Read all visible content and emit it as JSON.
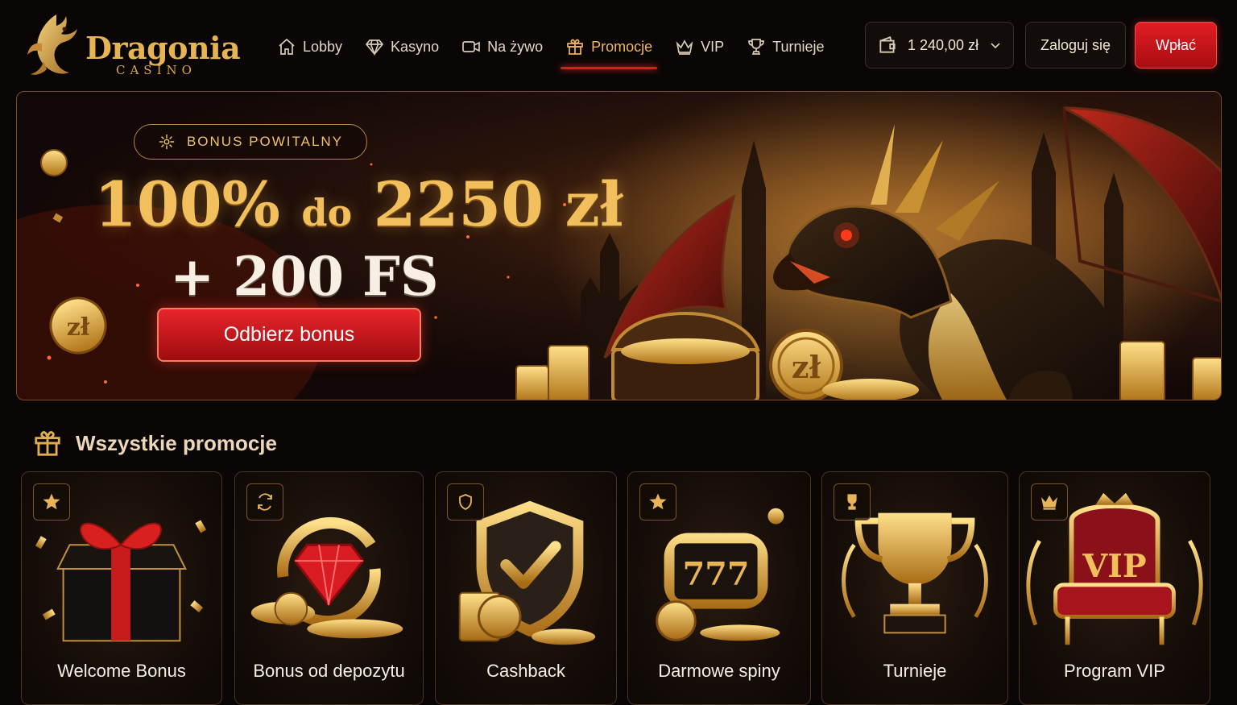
{
  "brand": {
    "name": "Dragonia",
    "sub": "CASINO"
  },
  "nav": [
    {
      "label": "Lobby",
      "icon": "home-icon"
    },
    {
      "label": "Kasyno",
      "icon": "diamond-icon"
    },
    {
      "label": "Na żywo",
      "icon": "video-icon"
    },
    {
      "label": "Promocje",
      "icon": "gift-icon",
      "active": true
    },
    {
      "label": "VIP",
      "icon": "crown-icon"
    },
    {
      "label": "Turnieje",
      "icon": "trophy-icon"
    }
  ],
  "wallet": {
    "balance": "1 240,00 zł",
    "icon": "wallet-icon"
  },
  "auth": {
    "login": "Zaloguj się",
    "deposit": "Wpłać"
  },
  "hero": {
    "badge": "BONUS POWITALNY",
    "percent": "100%",
    "connector": "do",
    "amount": "2250 zł",
    "spins": "+ 200 FS",
    "cta": "Odbierz bonus"
  },
  "promotions": {
    "title": "Wszystkie promocje",
    "cards": [
      {
        "label": "Welcome Bonus",
        "badge_icon": "star-icon"
      },
      {
        "label": "Bonus od depozytu",
        "badge_icon": "refresh-icon"
      },
      {
        "label": "Cashback",
        "badge_icon": "shield-icon"
      },
      {
        "label": "Darmowe spiny",
        "badge_icon": "star-icon"
      },
      {
        "label": "Turnieje",
        "badge_icon": "trophy-icon"
      },
      {
        "label": "Program VIP",
        "badge_icon": "crown-icon"
      }
    ]
  },
  "art_text": {
    "vip": "VIP",
    "slots": "777",
    "coin": "zł"
  },
  "colors": {
    "gold": "#e7b454",
    "accent_red": "#d42020",
    "background": "#0a0606"
  }
}
